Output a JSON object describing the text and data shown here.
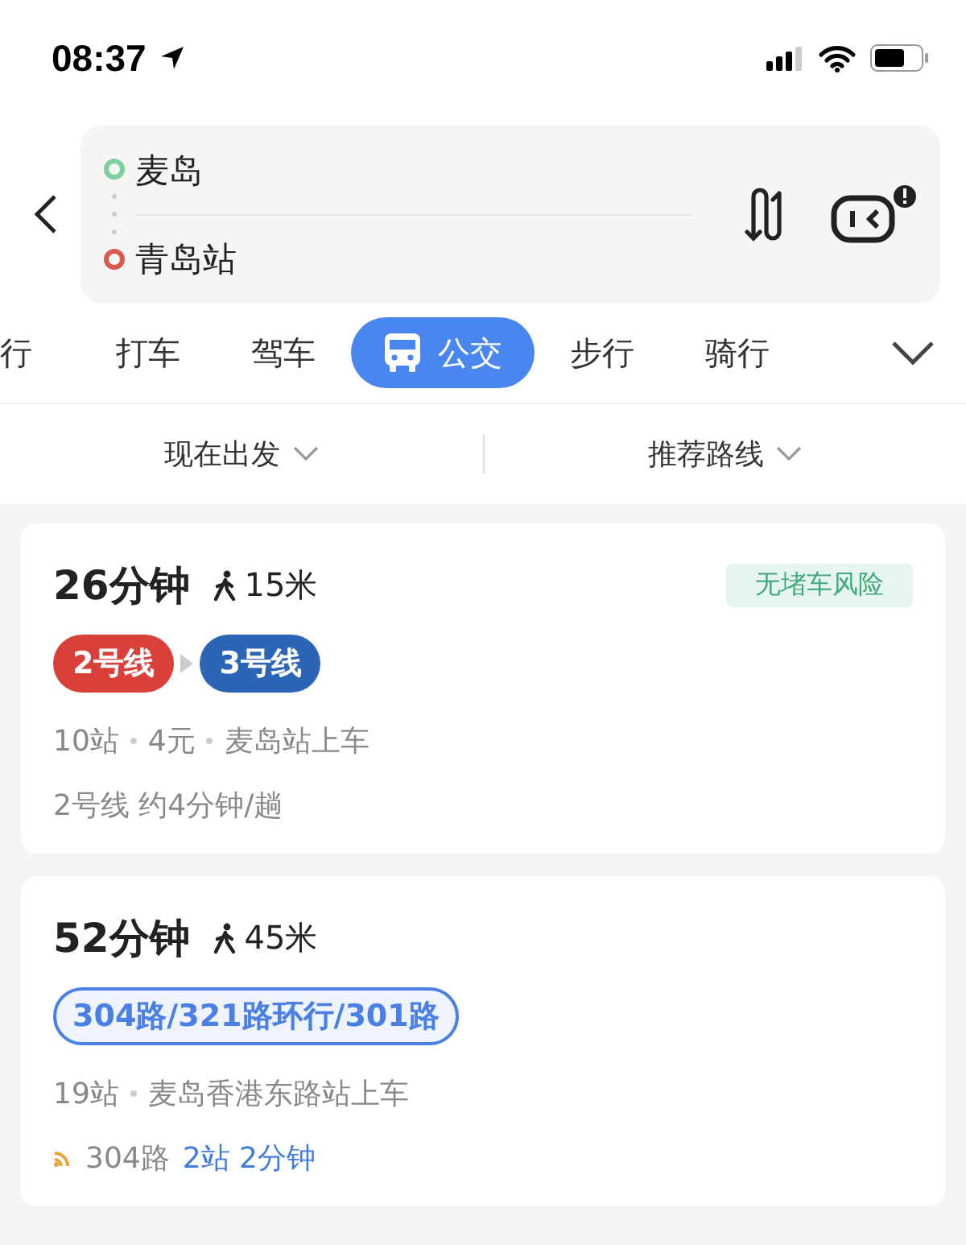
{
  "status_bar": {
    "time": "08:37"
  },
  "route_input": {
    "origin": "麦岛",
    "destination": "青岛站"
  },
  "modes": [
    {
      "label": "行",
      "selected": false,
      "kind": "text"
    },
    {
      "label": "打车",
      "selected": false,
      "kind": "text"
    },
    {
      "label": "驾车",
      "selected": false,
      "kind": "text"
    },
    {
      "label": "公交",
      "selected": true,
      "kind": "bus"
    },
    {
      "label": "步行",
      "selected": false,
      "kind": "text"
    },
    {
      "label": "骑行",
      "selected": false,
      "kind": "text"
    }
  ],
  "filters": [
    {
      "label": "现在出发"
    },
    {
      "label": "推荐路线"
    }
  ],
  "routes": [
    {
      "duration": "26分钟",
      "walk": "15米",
      "tag": "无堵车风险",
      "lines": [
        {
          "kind": "subway",
          "label": "2号线",
          "color": "#d9403a"
        },
        {
          "kind": "subway",
          "label": "3号线",
          "color": "#2c64b6"
        }
      ],
      "details": [
        "10站",
        "4元",
        "麦岛站上车"
      ],
      "note": {
        "realtime": false,
        "parts": [
          {
            "text": "2号线 约4分钟/趟",
            "highlight": false
          }
        ]
      }
    },
    {
      "duration": "52分钟",
      "walk": "45米",
      "lines": [
        {
          "kind": "bus",
          "label": "304路/321路环行/301路",
          "color": "#4a80e6"
        }
      ],
      "details": [
        "19站",
        "麦岛香港东路站上车"
      ],
      "note": {
        "realtime": true,
        "parts": [
          {
            "text": "304路",
            "highlight": false
          },
          {
            "text": "2站 2分钟",
            "highlight": true
          }
        ]
      }
    }
  ]
}
